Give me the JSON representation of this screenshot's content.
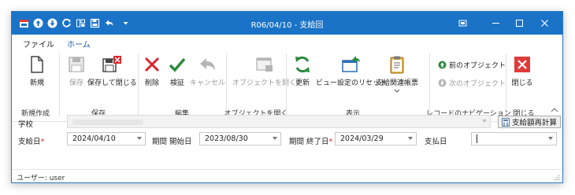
{
  "titlebar": {
    "title": "R06/04/10 - 支給回",
    "controls": [
      "restore-icon",
      "minimize-icon",
      "maximize-icon",
      "close-icon"
    ]
  },
  "tabs": [
    "ファイル",
    "ホーム"
  ],
  "ribbon": {
    "new_label": "新規",
    "save_label": "保存",
    "save_close_label": "保存して閉じる",
    "delete_label": "削除",
    "verify_label": "検証",
    "cancel_label": "キャンセル",
    "open_object_label": "オブジェクトを開く",
    "refresh_label": "更新",
    "reset_view_label": "ビュー設定のリセット",
    "payment_report_label": "支給関連帳票",
    "prev_object_label": "前のオブジェクト",
    "next_object_label": "次のオブジェクト",
    "close_label": "閉じる",
    "groups": {
      "new": "新規作成",
      "save": "保存",
      "edit": "編集",
      "open_object": "オブジェクトを開く",
      "view": "表示",
      "nav": "レコードのナビゲーション",
      "close": "閉じる"
    }
  },
  "form": {
    "school_label": "学校",
    "school_value": "",
    "recalc_label": "支給額再計算",
    "paydate_label": "支給日",
    "paydate_value": "2024/04/10",
    "period_start_label": "期間 開始日",
    "period_start_value": "2023/08/30",
    "period_end_label": "期間 終了日",
    "period_end_value": "2024/03/29",
    "paid_date_label": "支払日",
    "paid_date_value": ""
  },
  "status": {
    "user_text": "ユーザー: user"
  },
  "colors": {
    "titlebar": "#1a73c7",
    "accent_tab": "#1a5fa8",
    "required": "#d9242c",
    "delete_red": "#d9242c",
    "verify_green": "#2e8b3e"
  }
}
